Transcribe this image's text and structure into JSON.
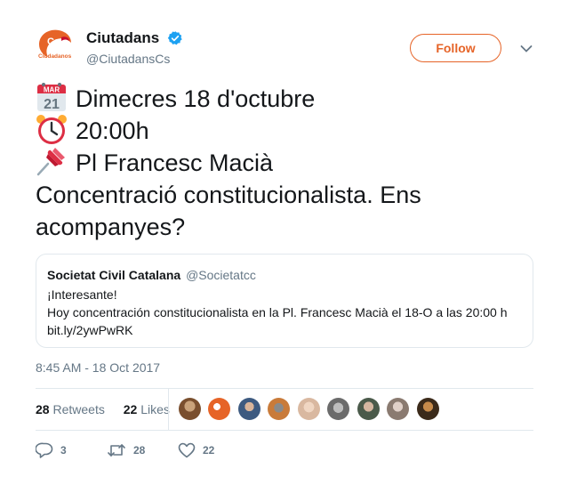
{
  "account": {
    "display_name": "Ciutadans",
    "handle": "@CiutadansCs",
    "logo_text": "Ciudadanos",
    "logo_mark": "Cs",
    "verified_icon": "verified-badge-icon"
  },
  "follow_label": "Follow",
  "tweet": {
    "calendar_emoji": {
      "icon": "calendar-icon",
      "month": "MAR",
      "day": "21"
    },
    "line1": "Dimecres 18 d'octubre",
    "line2": "20:00h",
    "line3": "Pl Francesc Macià",
    "line4": "Concentració constitucionalista. Ens acompanyes?"
  },
  "quote": {
    "name": "Societat Civil Catalana",
    "handle": "@Societatcc",
    "line1": "¡Interesante!",
    "line2": "Hoy concentración constitucionalista en la Pl. Francesc Macià el 18-O a las 20:00 h",
    "line3": "bit.ly/2ywPwRK"
  },
  "timestamp": "8:45 AM - 18 Oct 2017",
  "stats": {
    "retweets_count": "28",
    "retweets_label": "Retweets",
    "likes_count": "22",
    "likes_label": "Likes"
  },
  "liker_faces": [
    "#7a4f2e",
    "#e66428",
    "#3d5a80",
    "#c97b3a",
    "#d9b8a0",
    "#6b6b6b",
    "#4a5a4a",
    "#8a7a70",
    "#3b2a1a"
  ],
  "actions": {
    "replies": "3",
    "retweets": "28",
    "likes": "22"
  },
  "colors": {
    "accent": "#e66428",
    "verified": "#1da1f2",
    "muted": "#657786"
  }
}
